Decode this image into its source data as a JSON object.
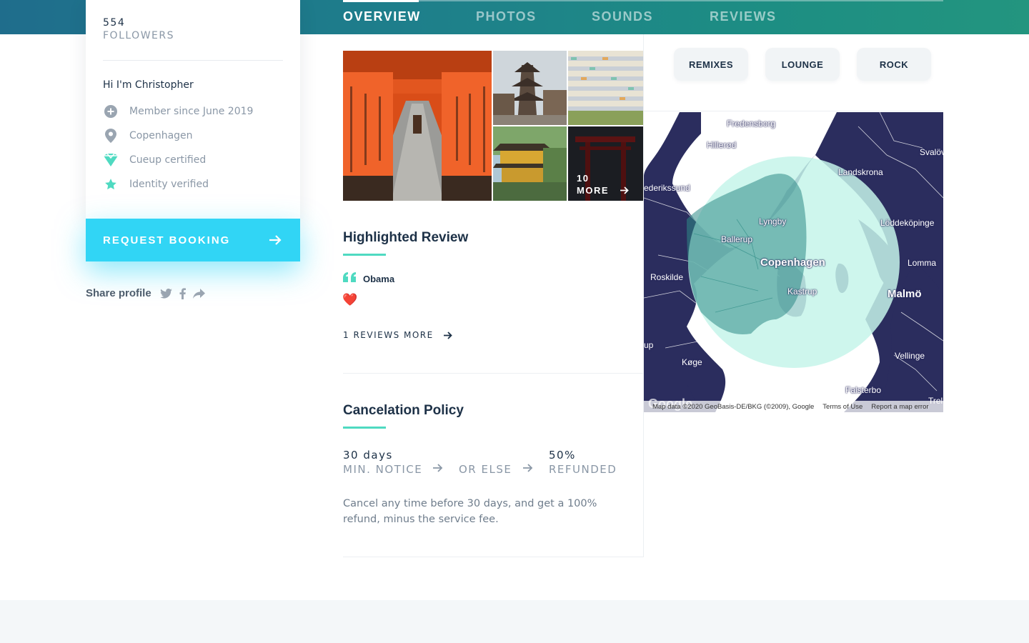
{
  "tabs": [
    "OVERVIEW",
    "PHOTOS",
    "SOUNDS",
    "REVIEWS"
  ],
  "profile": {
    "followers_count": "554",
    "followers_label": "FOLLOWERS",
    "greeting": "Hi I'm Christopher",
    "info": [
      {
        "icon": "plus-circle-icon",
        "text": "Member since June 2019"
      },
      {
        "icon": "location-pin-icon",
        "text": "Copenhagen"
      },
      {
        "icon": "cueup-badge-icon",
        "text": "Cueup certified"
      },
      {
        "icon": "star-icon",
        "text": "Identity verified"
      }
    ],
    "book_label": "REQUEST BOOKING",
    "share_label": "Share profile"
  },
  "gallery": {
    "more_count": "10",
    "more_label": "MORE"
  },
  "review": {
    "title": "Highlighted Review",
    "reviewer": "Obama",
    "content": "❤️",
    "more_label": "1 REVIEWS MORE"
  },
  "policy": {
    "title": "Cancelation Policy",
    "notice_value": "30 days",
    "notice_label": "MIN. NOTICE",
    "or_label": "OR ELSE",
    "refund_value": "50%",
    "refund_label": "REFUNDED",
    "text": "Cancel any time before 30 days, and get a 100% refund, minus the service fee."
  },
  "genres": [
    "REMIXES",
    "LOUNGE",
    "ROCK"
  ],
  "map": {
    "labels": {
      "fredensborg": "Fredensborg",
      "hillerod": "Hillerød",
      "svalov": "Svalöv",
      "landskrona": "Landskrona",
      "frederikssund": "ederikssund",
      "lyngby": "Lyngby",
      "loddekopinge": "Löddeköpinge",
      "ballerup": "Ballerup",
      "copenhagen": "Copenhagen",
      "lomma": "Lomma",
      "roskilde": "Roskilde",
      "kastrup": "Kastrup",
      "malmo": "Malmö",
      "vellinge": "Vellinge",
      "koge": "Køge",
      "falsterbo": "Falsterbo",
      "trelleborg": "Trel",
      "up": "up"
    },
    "google": "Google",
    "attribution": "Map data ©2020 GeoBasis-DE/BKG (©2009), Google",
    "terms": "Terms of Use",
    "report": "Report a map error",
    "colors": {
      "land": "#2b2d5e",
      "water": "#ffffff",
      "radius": "#c6f5ea"
    }
  }
}
